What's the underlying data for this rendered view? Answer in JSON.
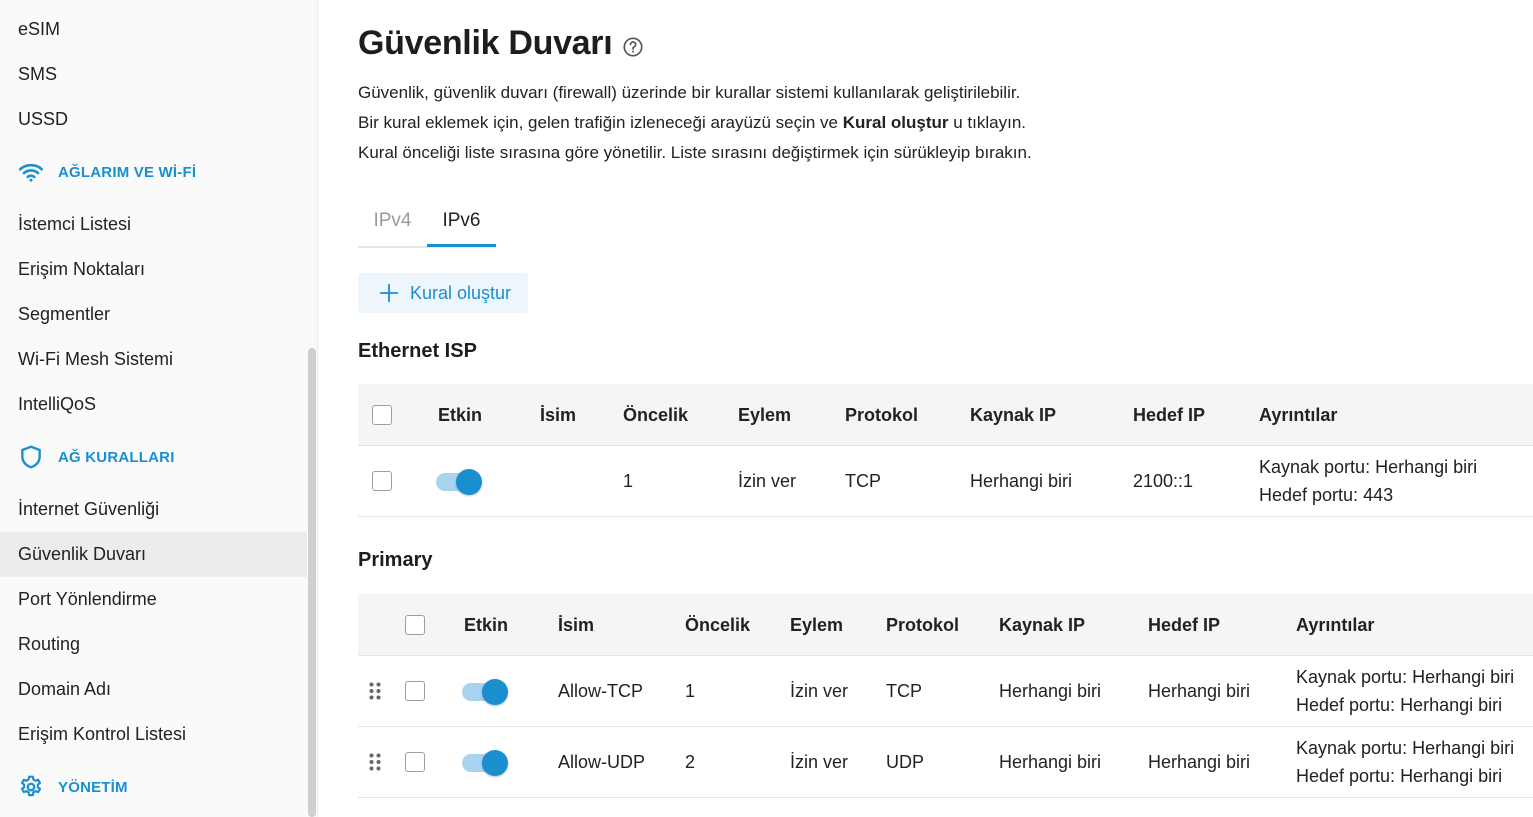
{
  "sidebar": {
    "items_top": [
      {
        "label": "eSIM"
      },
      {
        "label": "SMS"
      },
      {
        "label": "USSD"
      }
    ],
    "section_networks": {
      "label": "AĞLARIM VE Wİ-Fİ",
      "icon": "wifi-icon"
    },
    "items_networks": [
      {
        "label": "İstemci Listesi"
      },
      {
        "label": "Erişim Noktaları"
      },
      {
        "label": "Segmentler"
      },
      {
        "label": "Wi-Fi Mesh Sistemi"
      },
      {
        "label": "IntelliQoS"
      }
    ],
    "section_rules": {
      "label": "AĞ KURALLARI",
      "icon": "shield-icon"
    },
    "items_rules": [
      {
        "label": "İnternet Güvenliği"
      },
      {
        "label": "Güvenlik Duvarı",
        "active": true
      },
      {
        "label": "Port Yönlendirme"
      },
      {
        "label": "Routing"
      },
      {
        "label": "Domain Adı"
      },
      {
        "label": "Erişim Kontrol Listesi"
      }
    ],
    "section_admin": {
      "label": "YÖNETİM",
      "icon": "gear-icon"
    }
  },
  "page": {
    "title": "Güvenlik Duvarı",
    "desc1": "Güvenlik, güvenlik duvarı (firewall) üzerinde bir kurallar sistemi kullanılarak geliştirilebilir.",
    "desc2_pre": "Bir kural eklemek için, gelen trafiğin izleneceği arayüzü seçin ve ",
    "desc2_bold": "Kural oluştur",
    "desc2_post": " u tıklayın.",
    "desc3": "Kural önceliği liste sırasına göre yönetilir. Liste sırasını değiştirmek için sürükleyip bırakın.",
    "tabs": [
      {
        "label": "IPv4"
      },
      {
        "label": "IPv6",
        "active": true
      }
    ],
    "create_label": "Kural oluştur"
  },
  "columns": {
    "enabled": "Etkin",
    "name": "İsim",
    "priority": "Öncelik",
    "action": "Eylem",
    "protocol": "Protokol",
    "source_ip": "Kaynak IP",
    "dest_ip": "Hedef IP",
    "details": "Ayrıntılar"
  },
  "ethernet": {
    "title": "Ethernet ISP",
    "rows": [
      {
        "enabled": true,
        "name": "",
        "priority": "1",
        "action": "İzin ver",
        "protocol": "TCP",
        "source_ip": "Herhangi biri",
        "dest_ip": "2100::1",
        "detail_src": "Kaynak portu: Herhangi biri",
        "detail_dst": "Hedef portu: 443"
      }
    ]
  },
  "primary": {
    "title": "Primary",
    "rows": [
      {
        "enabled": true,
        "name": "Allow-TCP",
        "priority": "1",
        "action": "İzin ver",
        "protocol": "TCP",
        "source_ip": "Herhangi biri",
        "dest_ip": "Herhangi biri",
        "detail_src": "Kaynak portu: Herhangi biri",
        "detail_dst": "Hedef portu: Herhangi biri"
      },
      {
        "enabled": true,
        "name": "Allow-UDP",
        "priority": "2",
        "action": "İzin ver",
        "protocol": "UDP",
        "source_ip": "Herhangi biri",
        "dest_ip": "Herhangi biri",
        "detail_src": "Kaynak portu: Herhangi biri",
        "detail_dst": "Hedef portu: Herhangi biri"
      }
    ]
  },
  "colors": {
    "accent": "#1a8fd0",
    "toggle_track": "#a8d4ef",
    "active_bg": "#ececec"
  }
}
